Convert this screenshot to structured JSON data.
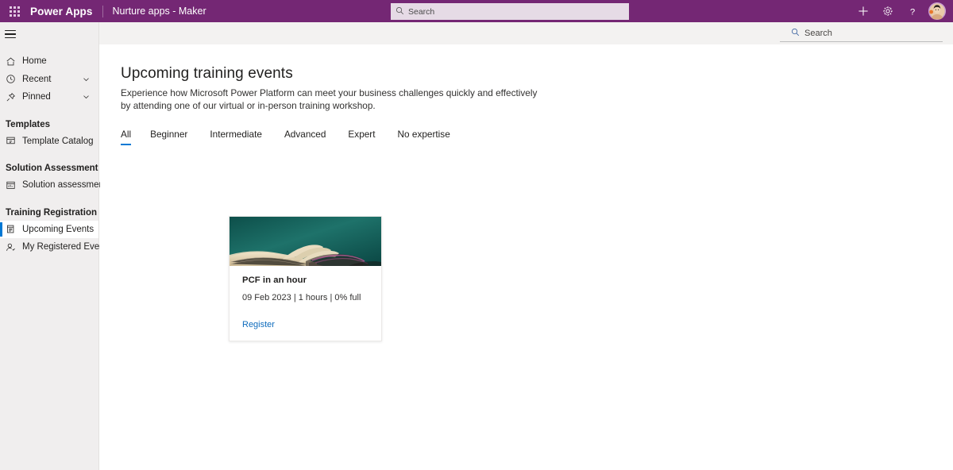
{
  "suitebar": {
    "waffle_icon": "waffle-grid-icon",
    "brand": "Power Apps",
    "app_name": "Nurture apps - Maker",
    "search": {
      "placeholder": "Search",
      "value": "",
      "icon": "search-icon"
    },
    "actions": [
      {
        "name": "new-button",
        "icon": "plus-icon",
        "label": "+"
      },
      {
        "name": "settings-button",
        "icon": "gear-icon",
        "label": ""
      },
      {
        "name": "help-button",
        "icon": "question-icon",
        "label": "?"
      }
    ],
    "avatar_label": "User avatar"
  },
  "commandbar": {
    "search": {
      "placeholder": "Search",
      "value": "",
      "icon": "search-icon"
    }
  },
  "sidebar": {
    "hamburger_icon": "hamburger-icon",
    "items": [
      {
        "label": "Home",
        "icon": "home-icon",
        "selected": false,
        "chevron": false
      },
      {
        "label": "Recent",
        "icon": "clock-icon",
        "selected": false,
        "chevron": true
      },
      {
        "label": "Pinned",
        "icon": "pin-icon",
        "selected": false,
        "chevron": true
      }
    ],
    "groups": [
      {
        "title": "Templates",
        "items": [
          {
            "label": "Template Catalog",
            "icon": "template-catalog-icon",
            "selected": false
          }
        ]
      },
      {
        "title": "Solution Assessment",
        "items": [
          {
            "label": "Solution assessment",
            "icon": "solution-assessment-icon",
            "selected": false
          }
        ]
      },
      {
        "title": "Training Registration",
        "items": [
          {
            "label": "Upcoming Events",
            "icon": "event-list-icon",
            "selected": true
          },
          {
            "label": "My Registered Events",
            "icon": "person-icon",
            "selected": false
          }
        ]
      }
    ]
  },
  "main": {
    "title": "Upcoming training events",
    "description": "Experience how Microsoft Power Platform can meet your business challenges quickly and effectively by attending one of our virtual or in-person training workshop.",
    "tabs": [
      {
        "label": "All",
        "active": true
      },
      {
        "label": "Beginner",
        "active": false
      },
      {
        "label": "Intermediate",
        "active": false
      },
      {
        "label": "Advanced",
        "active": false
      },
      {
        "label": "Expert",
        "active": false
      },
      {
        "label": "No expertise",
        "active": false
      }
    ],
    "cards": [
      {
        "image_alt": "open-book-photo",
        "title": "PCF in an hour",
        "meta": "09 Feb 2023 | 1 hours | 0% full",
        "link_label": "Register"
      }
    ]
  },
  "colors": {
    "suitebar_purple": "#742774",
    "command_bar": "#f3f2f1",
    "sidebar": "#f0eeee",
    "accent_blue": "#0078d4",
    "link_blue": "#0f6cbd",
    "card_image_teal": "#14544f"
  }
}
